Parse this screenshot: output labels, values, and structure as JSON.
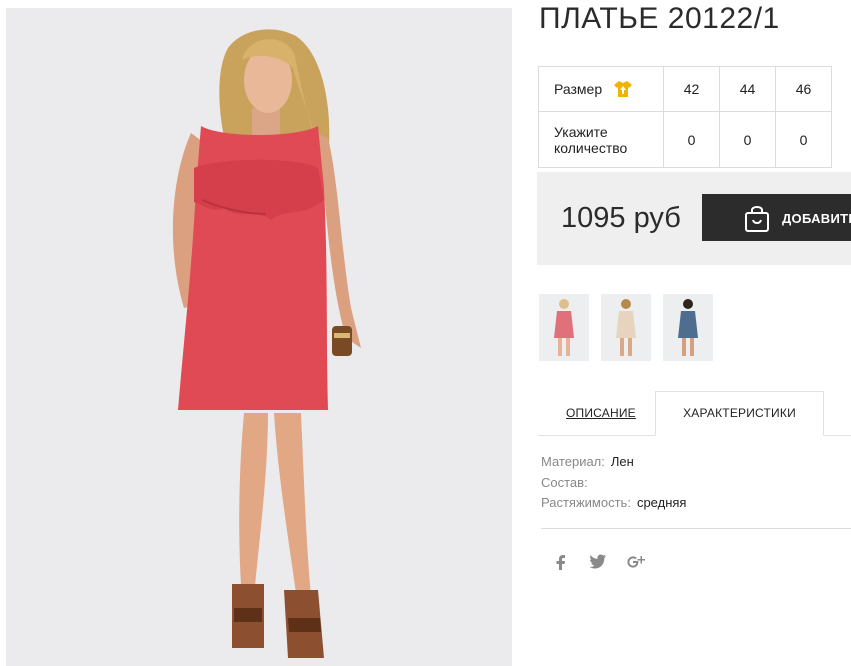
{
  "product": {
    "title": "ПЛАТЬЕ 20122/1"
  },
  "sizes": {
    "size_label": "Размер",
    "quantity_label": "Укажите количество",
    "values": [
      "42",
      "44",
      "46"
    ],
    "quantities": [
      "0",
      "0",
      "0"
    ]
  },
  "purchase": {
    "price": "1095 руб",
    "add_label": "ДОБАВИТЬ"
  },
  "thumbnails": [
    {
      "dress_color": "#e0707a"
    },
    {
      "dress_color": "#e6d4bf"
    },
    {
      "dress_color": "#4f6e8f"
    }
  ],
  "tabs": {
    "description": "ОПИСАНИЕ",
    "characteristics": "ХАРАКТЕРИСТИКИ"
  },
  "characteristics": [
    {
      "key": "Материал:",
      "value": "Лен"
    },
    {
      "key": "Состав:",
      "value": ""
    },
    {
      "key": "Растяжимость:",
      "value": "средняя"
    }
  ],
  "social": [
    "facebook-icon",
    "twitter-icon",
    "google-plus-icon"
  ],
  "colors": {
    "dress": "#e04a55",
    "button": "#2c2c2c",
    "size_icon": "#f0b400"
  }
}
